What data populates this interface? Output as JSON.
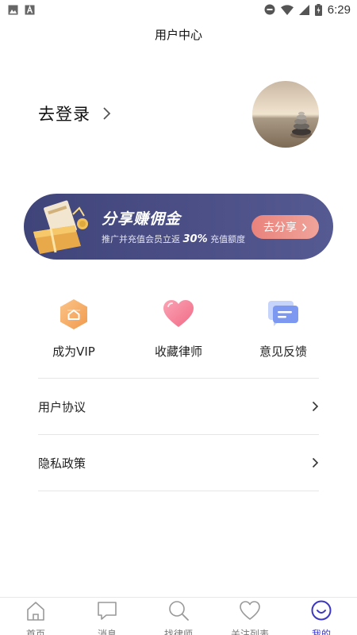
{
  "status_bar": {
    "time": "6:29",
    "left_icons": [
      "image-icon",
      "app-a-icon"
    ],
    "right_icons": [
      "dnd-icon",
      "wifi-icon",
      "signal-icon",
      "battery-icon"
    ]
  },
  "header": {
    "title": "用户中心"
  },
  "login": {
    "label": "去登录",
    "chevron": "chevron-right-icon"
  },
  "banner": {
    "title": "分享赚佣金",
    "subtitle_prefix": "推广并充值会员立返",
    "subtitle_percent": "30%",
    "subtitle_suffix": "充值额度",
    "button_label": "去分享"
  },
  "features": [
    {
      "label": "成为VIP",
      "icon": "vip-hexagon-icon"
    },
    {
      "label": "收藏律师",
      "icon": "heart-icon"
    },
    {
      "label": "意见反馈",
      "icon": "feedback-icon"
    }
  ],
  "menu": [
    {
      "label": "用户协议"
    },
    {
      "label": "隐私政策"
    }
  ],
  "nav": {
    "active_index": 4,
    "active_color": "#3b37c4",
    "inactive_color": "#999999",
    "items": [
      {
        "label": "首页",
        "icon": "home-icon"
      },
      {
        "label": "消息",
        "icon": "message-icon"
      },
      {
        "label": "找律师",
        "icon": "search-icon"
      },
      {
        "label": "关注列表",
        "icon": "heart-outline-icon"
      },
      {
        "label": "我的",
        "icon": "smile-face-icon"
      }
    ]
  },
  "colors": {
    "banner_bg": "#474b82",
    "share_button": "#ec8f86"
  }
}
